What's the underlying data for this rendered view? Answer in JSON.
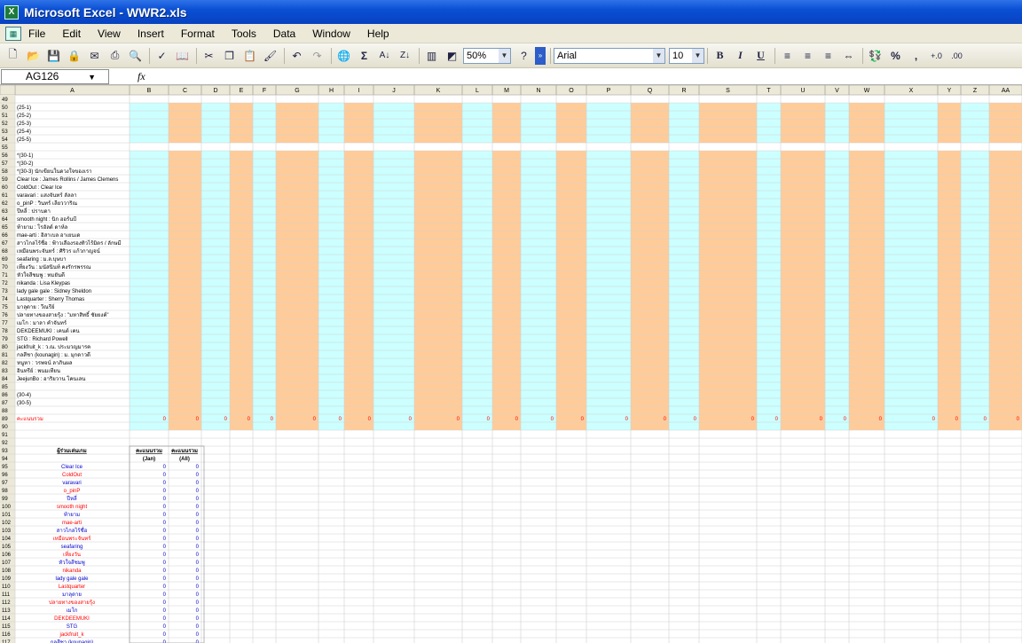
{
  "window": {
    "title": "Microsoft Excel - WWR2.xls"
  },
  "menu": [
    "File",
    "Edit",
    "View",
    "Insert",
    "Format",
    "Tools",
    "Data",
    "Window",
    "Help"
  ],
  "toolbar": {
    "zoom": "50%",
    "font": "Arial",
    "size": "10"
  },
  "namebox": "AG126",
  "columns": [
    "A",
    "B",
    "C",
    "D",
    "E",
    "F",
    "G",
    "H",
    "I",
    "J",
    "K",
    "L",
    "M",
    "N",
    "O",
    "P",
    "Q",
    "R",
    "S",
    "T",
    "U",
    "V",
    "W",
    "X",
    "Y",
    "Z",
    "AA"
  ],
  "upper_rows": [
    [
      "49",
      ""
    ],
    [
      "50",
      "(25-1)"
    ],
    [
      "51",
      "(25-2)"
    ],
    [
      "52",
      "(25-3)"
    ],
    [
      "53",
      "(25-4)"
    ],
    [
      "54",
      "(25-5)"
    ],
    [
      "55",
      ""
    ],
    [
      "56",
      "*(30-1)"
    ],
    [
      "57",
      "*(30-2)"
    ],
    [
      "58",
      "*(30-3) นักเขียนในดวงใจของเรา"
    ],
    [
      "59",
      "Clear Ice : James Rollins / James Clemens"
    ],
    [
      "60",
      "ColdOut : Clear Ice"
    ],
    [
      "61",
      "varavari : แสงจันทร์ ลัลลา"
    ],
    [
      "62",
      "o_pinP : วินทร์ เลียววาริณ"
    ],
    [
      "63",
      "ปีหลี่ : ปราบดา"
    ],
    [
      "64",
      "smooth night : นิก ฮอร์นบี"
    ],
    [
      "65",
      "ท้ายาม : โรอัลด์ ดาห์ล"
    ],
    [
      "66",
      "mae-arti : อิสาเบล อาเยนเด"
    ],
    [
      "67",
      "สาวไกลไร้ชื่อ : ฟ้าวเลืองรองทิวไร้มิตร / ลักษมี"
    ],
    [
      "68",
      "เหมือนพระจันทร์ : ศิริวร แก้วกาญจน์"
    ],
    [
      "69",
      "seafaring : ม.ล.บุษบา"
    ],
    [
      "70",
      "เที่ยงวัน : มนัสนินท์ คงรักรพรรณ"
    ],
    [
      "71",
      "หัวใจสีชมพู : ทมยันตี"
    ],
    [
      "72",
      "nikanda : Lisa Kleypas"
    ],
    [
      "73",
      "lady gale gale : Sidney Sheldon"
    ],
    [
      "74",
      "Lastquarter : Sherry Thomas"
    ],
    [
      "75",
      "มาลุดาย : วีณรีย์"
    ],
    [
      "76",
      "ปลายทางของสายรุ้ง : \"มหาสิทธิ์ ชัยยงค์\""
    ],
    [
      "77",
      "เมโก : มาลา คำจันทร์"
    ],
    [
      "78",
      "DEKDEEMUKI : เคนต์ เคน"
    ],
    [
      "79",
      "STG : Richard Powell"
    ],
    [
      "80",
      "jackfruit_k : ว.ณ. ประมวญมารค"
    ],
    [
      "81",
      "กลสีชา (kounagin) : ม. มุกดาวดี"
    ],
    [
      "82",
      "หนูหา : วรพจน์ ลาภินผล"
    ],
    [
      "83",
      "อินทรีย์ : พนมเทียน"
    ],
    [
      "84",
      "JeejunBo : อาริยวาน โคนเลน"
    ],
    [
      "85",
      ""
    ],
    [
      "86",
      "(30-4)"
    ],
    [
      "87",
      "(30-5)"
    ],
    [
      "88",
      ""
    ],
    [
      "89",
      "คะแนนรวม"
    ],
    [
      "90",
      ""
    ]
  ],
  "sum_values": [
    "0",
    "0",
    "0",
    "0",
    "0",
    "0",
    "0",
    "0",
    "0",
    "0",
    "0",
    "0",
    "0",
    "0",
    "0",
    "0",
    "0",
    "0",
    "0",
    "0",
    "0",
    "0",
    "0",
    "0",
    "0",
    "0"
  ],
  "lower_rows": [
    [
      "91",
      "",
      "",
      ""
    ],
    [
      "92",
      "",
      "",
      ""
    ],
    [
      "93",
      "ผู้ร่วมเล่นเกม",
      "คะแนนรวม",
      "คะแนนรวม"
    ],
    [
      "94",
      "",
      "(Jan)",
      "(All)"
    ],
    [
      "95",
      "Clear Ice",
      "0",
      "0"
    ],
    [
      "96",
      "ColdOut",
      "0",
      "0"
    ],
    [
      "97",
      "varavari",
      "0",
      "0"
    ],
    [
      "98",
      "o_pinP",
      "0",
      "0"
    ],
    [
      "99",
      "ปีหลี่",
      "0",
      "0"
    ],
    [
      "100",
      "smooth night",
      "0",
      "0"
    ],
    [
      "101",
      "ท้ายาม",
      "0",
      "0"
    ],
    [
      "102",
      "mae-arti",
      "0",
      "0"
    ],
    [
      "103",
      "สาวไกลไร้ชื่อ",
      "0",
      "0"
    ],
    [
      "104",
      "เหมือนพระจันทร์",
      "0",
      "0"
    ],
    [
      "105",
      "seafaring",
      "0",
      "0"
    ],
    [
      "106",
      "เที่ยงวัน",
      "0",
      "0"
    ],
    [
      "107",
      "หัวใจสีชมพู",
      "0",
      "0"
    ],
    [
      "108",
      "nikanda",
      "0",
      "0"
    ],
    [
      "109",
      "lady gale gale",
      "0",
      "0"
    ],
    [
      "110",
      "Lastquarter",
      "0",
      "0"
    ],
    [
      "111",
      "มาลุดาย",
      "0",
      "0"
    ],
    [
      "112",
      "ปลายทางของสายรุ้ง",
      "0",
      "0"
    ],
    [
      "113",
      "เมโก",
      "0",
      "0"
    ],
    [
      "114",
      "DEKDEEMUKI",
      "0",
      "0"
    ],
    [
      "115",
      "STG",
      "0",
      "0"
    ],
    [
      "116",
      "jackfruit_k",
      "0",
      "0"
    ],
    [
      "117",
      "กลสีชา (kounagin)",
      "0",
      "0"
    ]
  ],
  "colors": {
    "cyan": "#ccffff",
    "peach": "#ffcc99",
    "header": "#ece9d8",
    "red_text": "#ff0000",
    "blue_text": "#0000cc"
  }
}
